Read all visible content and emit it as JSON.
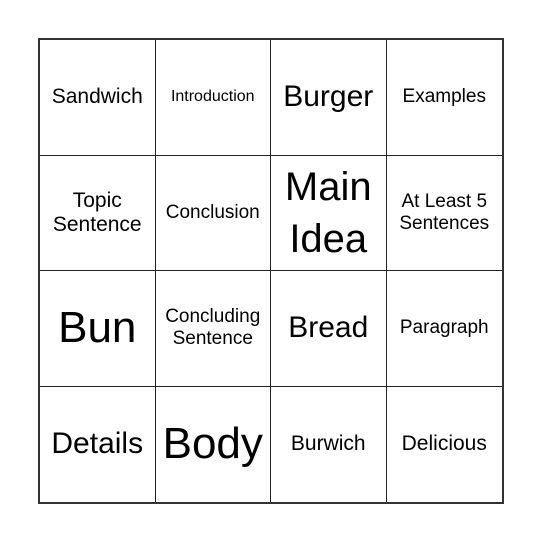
{
  "board": {
    "cells": [
      {
        "text": "Sandwich"
      },
      {
        "text": "Introduction"
      },
      {
        "text": "Burger"
      },
      {
        "text": "Examples"
      },
      {
        "text": "Topic Sentence"
      },
      {
        "text": "Conclusion"
      },
      {
        "text": "Main Idea"
      },
      {
        "text": "At Least 5 Sentences"
      },
      {
        "text": "Bun"
      },
      {
        "text": "Concluding Sentence"
      },
      {
        "text": "Bread"
      },
      {
        "text": "Paragraph"
      },
      {
        "text": "Details"
      },
      {
        "text": "Body"
      },
      {
        "text": "Burwich"
      },
      {
        "text": "Delicious"
      }
    ]
  }
}
